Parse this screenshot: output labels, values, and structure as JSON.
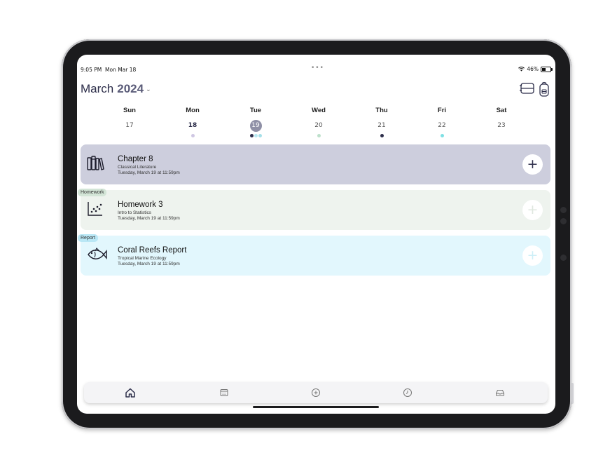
{
  "status_bar": {
    "time": "9:05 PM",
    "date": "Mon Mar 18",
    "battery": "46%",
    "more": "•••"
  },
  "header": {
    "month": "March",
    "year": "2024",
    "chevron_icon": "chevron-down-icon",
    "actions": [
      "list-view-icon",
      "backpack-icon"
    ]
  },
  "week": {
    "days": [
      {
        "name": "Sun",
        "num": "17",
        "dots": []
      },
      {
        "name": "Mon",
        "num": "18",
        "dots": [
          "#cfc7e3"
        ],
        "bold": true
      },
      {
        "name": "Tue",
        "num": "19",
        "dots": [
          "#2d2e4a",
          "#b7e9f2",
          "#a5dfe8"
        ],
        "selected": true
      },
      {
        "name": "Wed",
        "num": "20",
        "dots": [
          "#bde0cb"
        ]
      },
      {
        "name": "Thu",
        "num": "21",
        "dots": [
          "#2d2e4a"
        ]
      },
      {
        "name": "Fri",
        "num": "22",
        "dots": [
          "#7fe0e4"
        ]
      },
      {
        "name": "Sat",
        "num": "23",
        "dots": []
      }
    ]
  },
  "tasks": [
    {
      "title": "Chapter 8",
      "course": "Classical Literature",
      "due": "Tuesday, March 19 at 11:59pm",
      "tag": "",
      "icon": "books-icon",
      "bg": "#cdcedd",
      "add_color": "#2d2e4a"
    },
    {
      "title": "Homework 3",
      "course": "Intro to Statistics",
      "due": "Tuesday, March 19 at 11:59pm",
      "tag": "Homework",
      "icon": "scatter-plot-icon",
      "bg": "#eef3ee",
      "tag_bg": "#d3e5d7",
      "add_color": "#dfe7df"
    },
    {
      "title": "Coral Reefs Report",
      "course": "Tropical Marine Ecology",
      "due": "Tuesday, March 19 at 11:59pm",
      "tag": "Report",
      "icon": "fish-icon",
      "bg": "#e2f7fd",
      "tag_bg": "#b9e7f5",
      "add_color": "#cdeff7"
    }
  ],
  "tab_bar": {
    "tabs": [
      {
        "name": "home",
        "icon": "home-icon",
        "active": true
      },
      {
        "name": "calendar",
        "icon": "calendar-icon"
      },
      {
        "name": "add",
        "icon": "plus-circle-icon"
      },
      {
        "name": "history",
        "icon": "clock-icon"
      },
      {
        "name": "inbox",
        "icon": "inbox-icon"
      }
    ]
  },
  "colors": {
    "accent": "#2d2e4a",
    "selected_day": "#8f90a6"
  }
}
